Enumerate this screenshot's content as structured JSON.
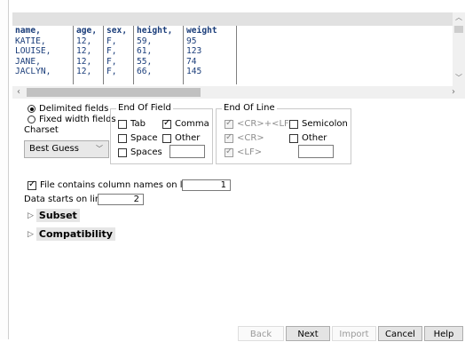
{
  "preview": {
    "columns": [
      {
        "cells": [
          "name,",
          "KATIE,",
          "LOUISE,",
          "JANE,",
          "JACLYN,"
        ]
      },
      {
        "cells": [
          "age,",
          "12,",
          "12,",
          "12,",
          "12,"
        ]
      },
      {
        "cells": [
          "sex,",
          "F,",
          "F,",
          "F,",
          "F,"
        ]
      },
      {
        "cells": [
          "height,",
          "59,",
          "61,",
          "55,",
          "66,"
        ]
      },
      {
        "cells": [
          "weight",
          "95",
          "123",
          "74",
          "145"
        ]
      }
    ]
  },
  "format": {
    "delimited_label": "Delimited fields",
    "fixed_label": "Fixed width fields",
    "delimited_selected": true,
    "charset_label": "Charset",
    "charset_value": "Best Guess"
  },
  "end_of_field": {
    "title": "End Of Field",
    "tab": "Tab",
    "tab_checked": false,
    "comma": "Comma",
    "comma_checked": true,
    "space": "Space",
    "space_checked": false,
    "other": "Other",
    "other_checked": false,
    "spaces": "Spaces",
    "spaces_checked": false,
    "other_value": ""
  },
  "end_of_line": {
    "title": "End Of Line",
    "crlf": "<CR>+<LF>",
    "crlf_checked": true,
    "semicolon": "Semicolon",
    "semicolon_checked": false,
    "cr": "<CR>",
    "cr_checked": true,
    "other": "Other",
    "other_checked": false,
    "lf": "<LF>",
    "lf_checked": true,
    "other_value": ""
  },
  "options": {
    "column_names_label": "File contains column names on line:",
    "column_names_checked": true,
    "column_names_line": "1",
    "data_starts_label": "Data starts on line:",
    "data_starts_line": "2"
  },
  "sections": {
    "subset": "Subset",
    "compatibility": "Compatibility"
  },
  "buttons": {
    "back": "Back",
    "next": "Next",
    "import": "Import",
    "cancel": "Cancel",
    "help": "Help"
  }
}
